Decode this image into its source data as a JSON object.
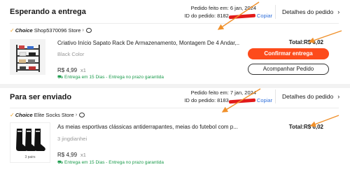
{
  "orders": [
    {
      "status": "Esperando a entrega",
      "order_date": "Pedido feito em: 6 jan, 2024",
      "order_id_label": "ID do pedido:",
      "order_id_prefix": "8182",
      "copy_label": "Copiar",
      "details_label": "Detalhes do pedido",
      "choice_label": "Choice",
      "store_name": "Shop5370096 Store",
      "product_title": "Criativo Início Sapato Rack De Armazenamento, Montagem De 4 Andar,...",
      "variant": "Black Color",
      "price": "R$ 4,99",
      "quantity": "x1",
      "delivery": "Entrega em 15 Dias - Entrega no prazo garantida",
      "total": "Total:R$ 6,02",
      "buttons": {
        "confirm": "Confirmar entrega",
        "track": "Acompanhar Pedido"
      }
    },
    {
      "status": "Para ser enviado",
      "order_date": "Pedido feito em: 7 jan, 2024",
      "order_id_label": "ID do pedido:",
      "order_id_prefix": "8183",
      "copy_label": "Copiar",
      "details_label": "Detalhes do pedido",
      "choice_label": "Choice",
      "store_name": "Elite Socks Store",
      "product_title": "As meias esportivas clássicas antiderrapantes, meias do futebol com p...",
      "variant": "3 jingdianhei",
      "price": "R$ 4,99",
      "quantity": "x1",
      "delivery": "Entrega em 15 Dias - Entrega no prazo garantida",
      "total": "Total:R$ 6,02",
      "thumb_caption": "3 pairs"
    }
  ],
  "colors": {
    "primary_button": "#fd4b1b",
    "delivery_green": "#1a9b4b",
    "copy_link": "#2f6fda",
    "annotation_arrow": "#f0902a",
    "redaction": "#e21a1a"
  },
  "icons": [
    "choice-check-icon",
    "chevron-right-icon",
    "chat-icon",
    "truck-icon",
    "shoe-rack-image",
    "socks-image"
  ]
}
